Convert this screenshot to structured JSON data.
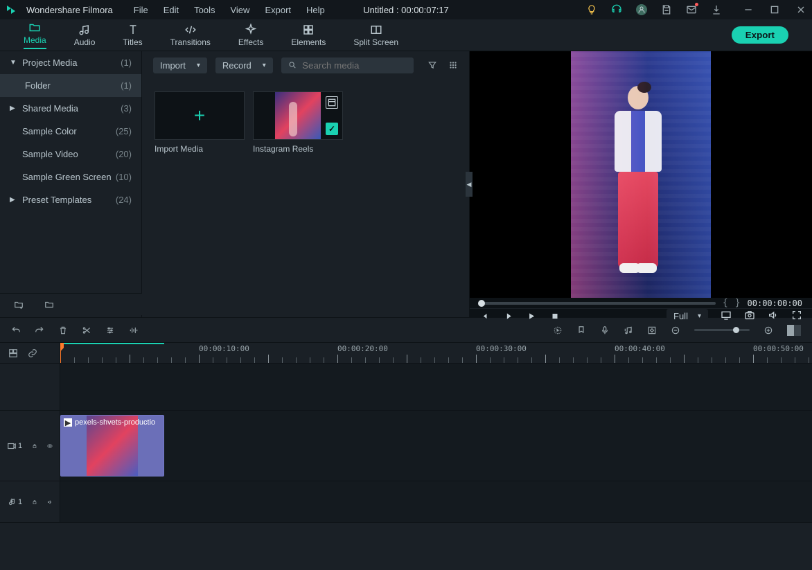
{
  "app_name": "Wondershare Filmora",
  "menus": [
    "File",
    "Edit",
    "Tools",
    "View",
    "Export",
    "Help"
  ],
  "doc_title": "Untitled : 00:00:07:17",
  "tabs": [
    {
      "label": "Media"
    },
    {
      "label": "Audio"
    },
    {
      "label": "Titles"
    },
    {
      "label": "Transitions"
    },
    {
      "label": "Effects"
    },
    {
      "label": "Elements"
    },
    {
      "label": "Split Screen"
    }
  ],
  "export_btn": "Export",
  "sidebar": {
    "items": [
      {
        "label": "Project Media",
        "count": "(1)",
        "chev": "▼"
      },
      {
        "label": "Folder",
        "count": "(1)",
        "sub": true,
        "active": true
      },
      {
        "label": "Shared Media",
        "count": "(3)",
        "chev": "▶"
      },
      {
        "label": "Sample Color",
        "count": "(25)"
      },
      {
        "label": "Sample Video",
        "count": "(20)"
      },
      {
        "label": "Sample Green Screen",
        "count": "(10)"
      },
      {
        "label": "Preset Templates",
        "count": "(24)",
        "chev": "▶"
      }
    ]
  },
  "media": {
    "import": "Import",
    "record": "Record",
    "search_placeholder": "Search media",
    "tiles": [
      {
        "label": "Import Media"
      },
      {
        "label": "Instagram Reels"
      }
    ]
  },
  "preview": {
    "timecode": "00:00:00:00",
    "quality": "Full"
  },
  "timeline": {
    "ruler": [
      "00:00:10:00",
      "00:00:20:00",
      "00:00:30:00",
      "00:00:40:00",
      "00:00:50:00"
    ],
    "video_track_label": "1",
    "audio_track_label": "1",
    "clip_name": "pexels-shvets-productio"
  }
}
